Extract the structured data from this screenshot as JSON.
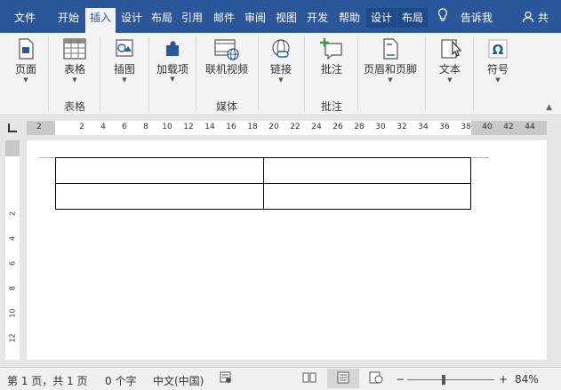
{
  "tabs": [
    {
      "label": "文件"
    },
    {
      "label": "开始"
    },
    {
      "label": "插入"
    },
    {
      "label": "设计"
    },
    {
      "label": "布局"
    },
    {
      "label": "引用"
    },
    {
      "label": "邮件"
    },
    {
      "label": "审阅"
    },
    {
      "label": "视图"
    },
    {
      "label": "开发"
    },
    {
      "label": "帮助"
    },
    {
      "label": "设计"
    },
    {
      "label": "布局"
    }
  ],
  "tellme": "告诉我",
  "share": "共",
  "ribbon": {
    "page": "页面",
    "table": "表格",
    "illustrations": "插图",
    "addins": "加载项",
    "online_video": "联机视频",
    "links": "链接",
    "comment": "批注",
    "header_footer": "页眉和页脚",
    "text": "文本",
    "symbols": "符号",
    "group_table": "表格",
    "group_media": "媒体",
    "group_comments": "批注"
  },
  "ruler_numbers": [
    "2",
    "2",
    "4",
    "6",
    "8",
    "10",
    "12",
    "14",
    "16",
    "18",
    "20",
    "22",
    "24",
    "26",
    "28",
    "30",
    "32",
    "34",
    "36",
    "38",
    "40",
    "42",
    "44"
  ],
  "vruler_numbers": [
    "2",
    "4",
    "6",
    "8",
    "10",
    "12"
  ],
  "status": {
    "page": "第 1 页，共 1 页",
    "words": "0 个字",
    "language": "中文(中国)",
    "zoom": "84%"
  },
  "colors": {
    "accent": "#2b579a",
    "ribbon": "#f3f3f3",
    "canvas": "#e6e6e6"
  }
}
